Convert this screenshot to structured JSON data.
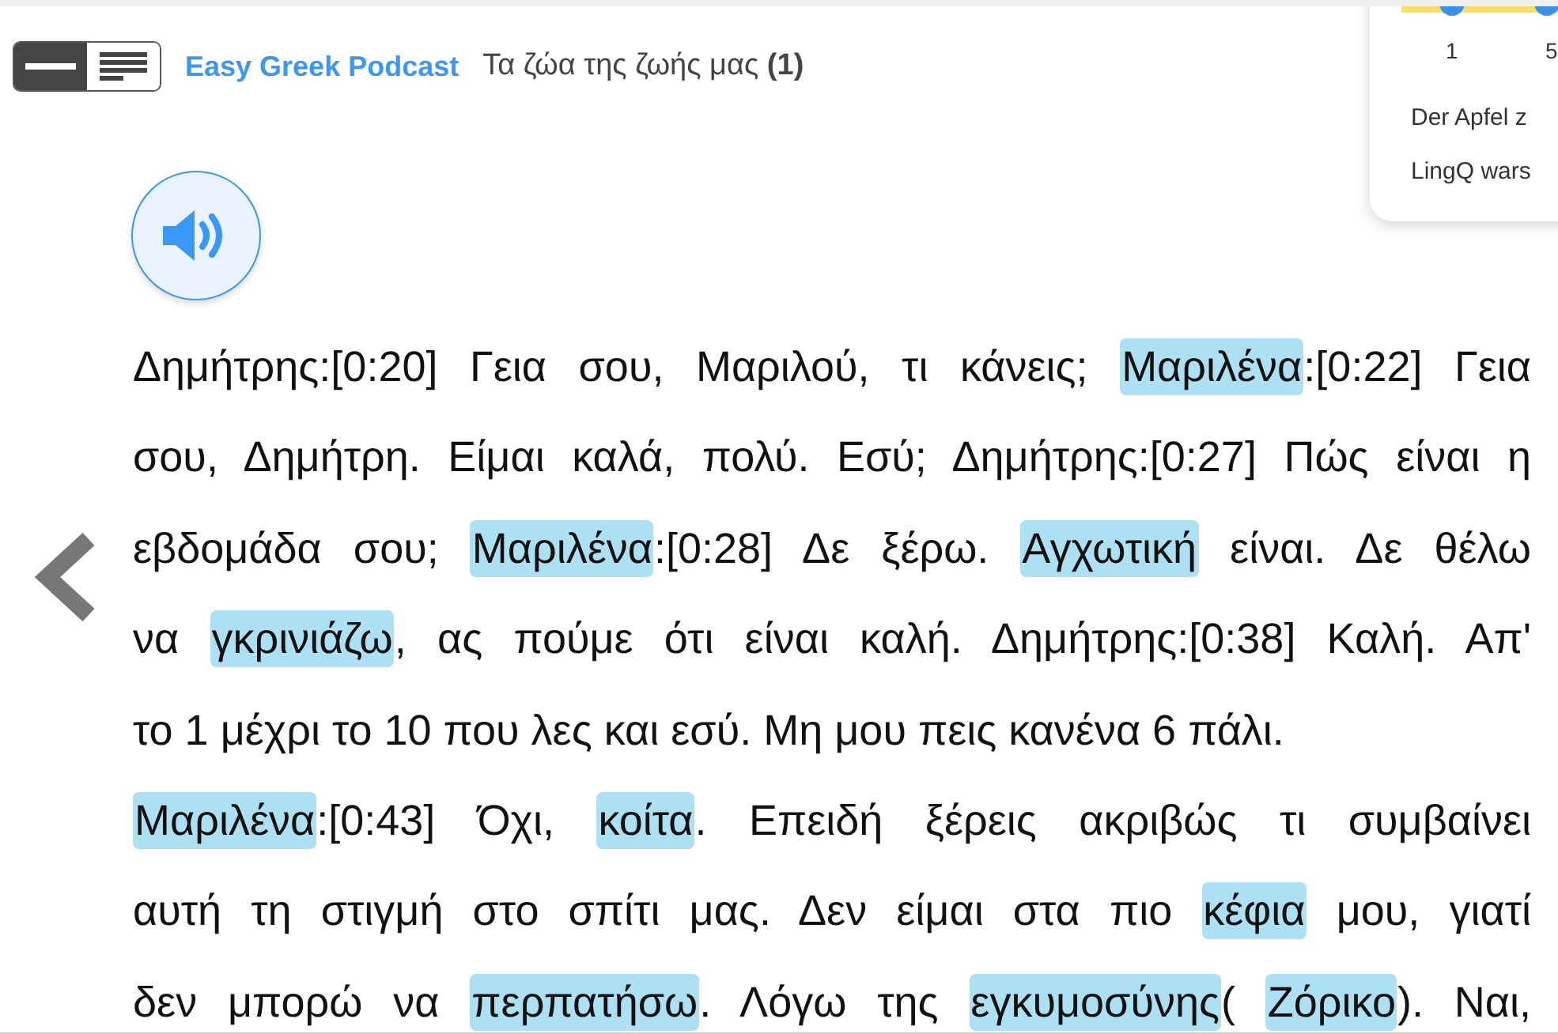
{
  "header": {
    "view_toggle": [
      {
        "kind": "single",
        "selected": true
      },
      {
        "kind": "list",
        "selected": false
      }
    ],
    "course": "Easy Greek Podcast",
    "lesson": "Τα ζώα της ζωής μας",
    "lesson_part": "(1)"
  },
  "popup": {
    "counts": [
      "1",
      "5"
    ],
    "lines": [
      "Der Apfel z",
      "LingQ wars"
    ]
  },
  "transcript": [
    {
      "justified": true,
      "segments": [
        {
          "text": "Δημήτρης:[0:20] Γεια σου, Μαριλού, τι κάνεις; ",
          "highlighted": false
        },
        {
          "text": "Μαριλένα",
          "highlighted": true
        },
        {
          "text": ":[0:22] Γεια",
          "highlighted": false
        }
      ]
    },
    {
      "justified": true,
      "segments": [
        {
          "text": "σου, Δημήτρη. Είμαι καλά, πολύ. Εσύ; Δημήτρης:[0:27] Πώς είναι η",
          "highlighted": false
        }
      ]
    },
    {
      "justified": true,
      "segments": [
        {
          "text": "εβδομάδα σου; ",
          "highlighted": false
        },
        {
          "text": "Μαριλένα",
          "highlighted": true
        },
        {
          "text": ":[0:28] Δε ξέρω. ",
          "highlighted": false
        },
        {
          "text": "Αγχωτική",
          "highlighted": true
        },
        {
          "text": " είναι. Δε θέλω",
          "highlighted": false
        }
      ]
    },
    {
      "justified": true,
      "segments": [
        {
          "text": "να ",
          "highlighted": false
        },
        {
          "text": "γκρινιάζω",
          "highlighted": true
        },
        {
          "text": ", ας πούμε ότι είναι καλή. Δημήτρης:[0:38] Καλή. Απ'",
          "highlighted": false
        }
      ]
    },
    {
      "justified": false,
      "segments": [
        {
          "text": "το 1 μέχρι το 10 που λες και εσύ. Μη μου πεις κανένα 6 πάλι.",
          "highlighted": false
        }
      ]
    },
    {
      "justified": true,
      "segments": [
        {
          "text": "Μαριλένα",
          "highlighted": true
        },
        {
          "text": ":[0:43] Όχι, ",
          "highlighted": false
        },
        {
          "text": "κοίτα",
          "highlighted": true
        },
        {
          "text": ". Επειδή ξέρεις ακριβώς τι συμβαίνει",
          "highlighted": false
        }
      ]
    },
    {
      "justified": true,
      "segments": [
        {
          "text": "αυτή τη στιγμή στο σπίτι μας. Δεν είμαι στα πιο ",
          "highlighted": false
        },
        {
          "text": "κέφια",
          "highlighted": true
        },
        {
          "text": " μου, γιατί",
          "highlighted": false
        }
      ]
    },
    {
      "justified": true,
      "segments": [
        {
          "text": "δεν μπορώ να ",
          "highlighted": false
        },
        {
          "text": "περπατήσω",
          "highlighted": true
        },
        {
          "text": ". Λόγω της ",
          "highlighted": false
        },
        {
          "text": "εγκυμοσύνης",
          "highlighted": true
        },
        {
          "text": "( ",
          "highlighted": false
        },
        {
          "text": "Ζόρικο",
          "highlighted": true
        },
        {
          "text": "). Ναι,",
          "highlighted": false
        }
      ]
    }
  ]
}
